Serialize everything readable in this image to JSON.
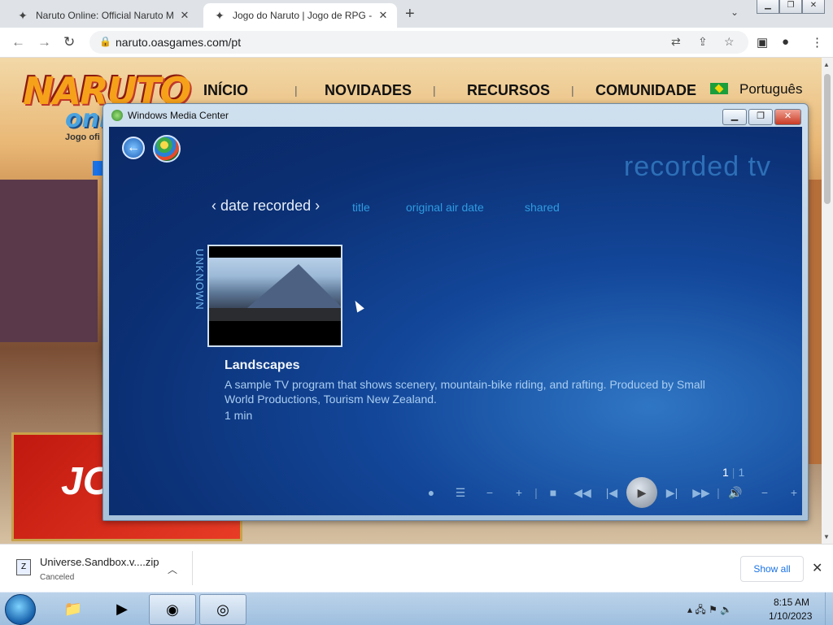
{
  "browser": {
    "tabs": [
      {
        "title": "Naruto Online: Official Naruto M",
        "active": false
      },
      {
        "title": "Jogo do Naruto | Jogo de RPG - ",
        "active": true
      }
    ],
    "new_tab": "+",
    "url": "naruto.oasgames.com/pt"
  },
  "site": {
    "logo_main": "NARUTO",
    "logo_sub": "online",
    "tagline": "Jogo ofi",
    "nav": [
      "INÍCIO",
      "NOVIDADES",
      "RECURSOS",
      "COMUNIDADE"
    ],
    "language": "Português",
    "banner_text": "JO"
  },
  "wmc": {
    "window_title": "Windows Media Center",
    "section_title": "recorded tv",
    "sort_active": "date recorded",
    "sort_options": [
      "title",
      "original air date",
      "shared"
    ],
    "side_label": "UNKNOWN",
    "program": {
      "name": "Landscapes",
      "description": "A sample TV program that shows scenery, mountain-bike riding, and rafting. Produced by Small World Productions, Tourism New Zealand.",
      "duration": "1 min"
    },
    "pager": {
      "current": "1",
      "total": "1"
    }
  },
  "download": {
    "filename": "Universe.Sandbox.v....zip",
    "status": "Canceled",
    "show_all": "Show all"
  },
  "taskbar": {
    "time": "8:15 AM",
    "date": "1/10/2023"
  }
}
